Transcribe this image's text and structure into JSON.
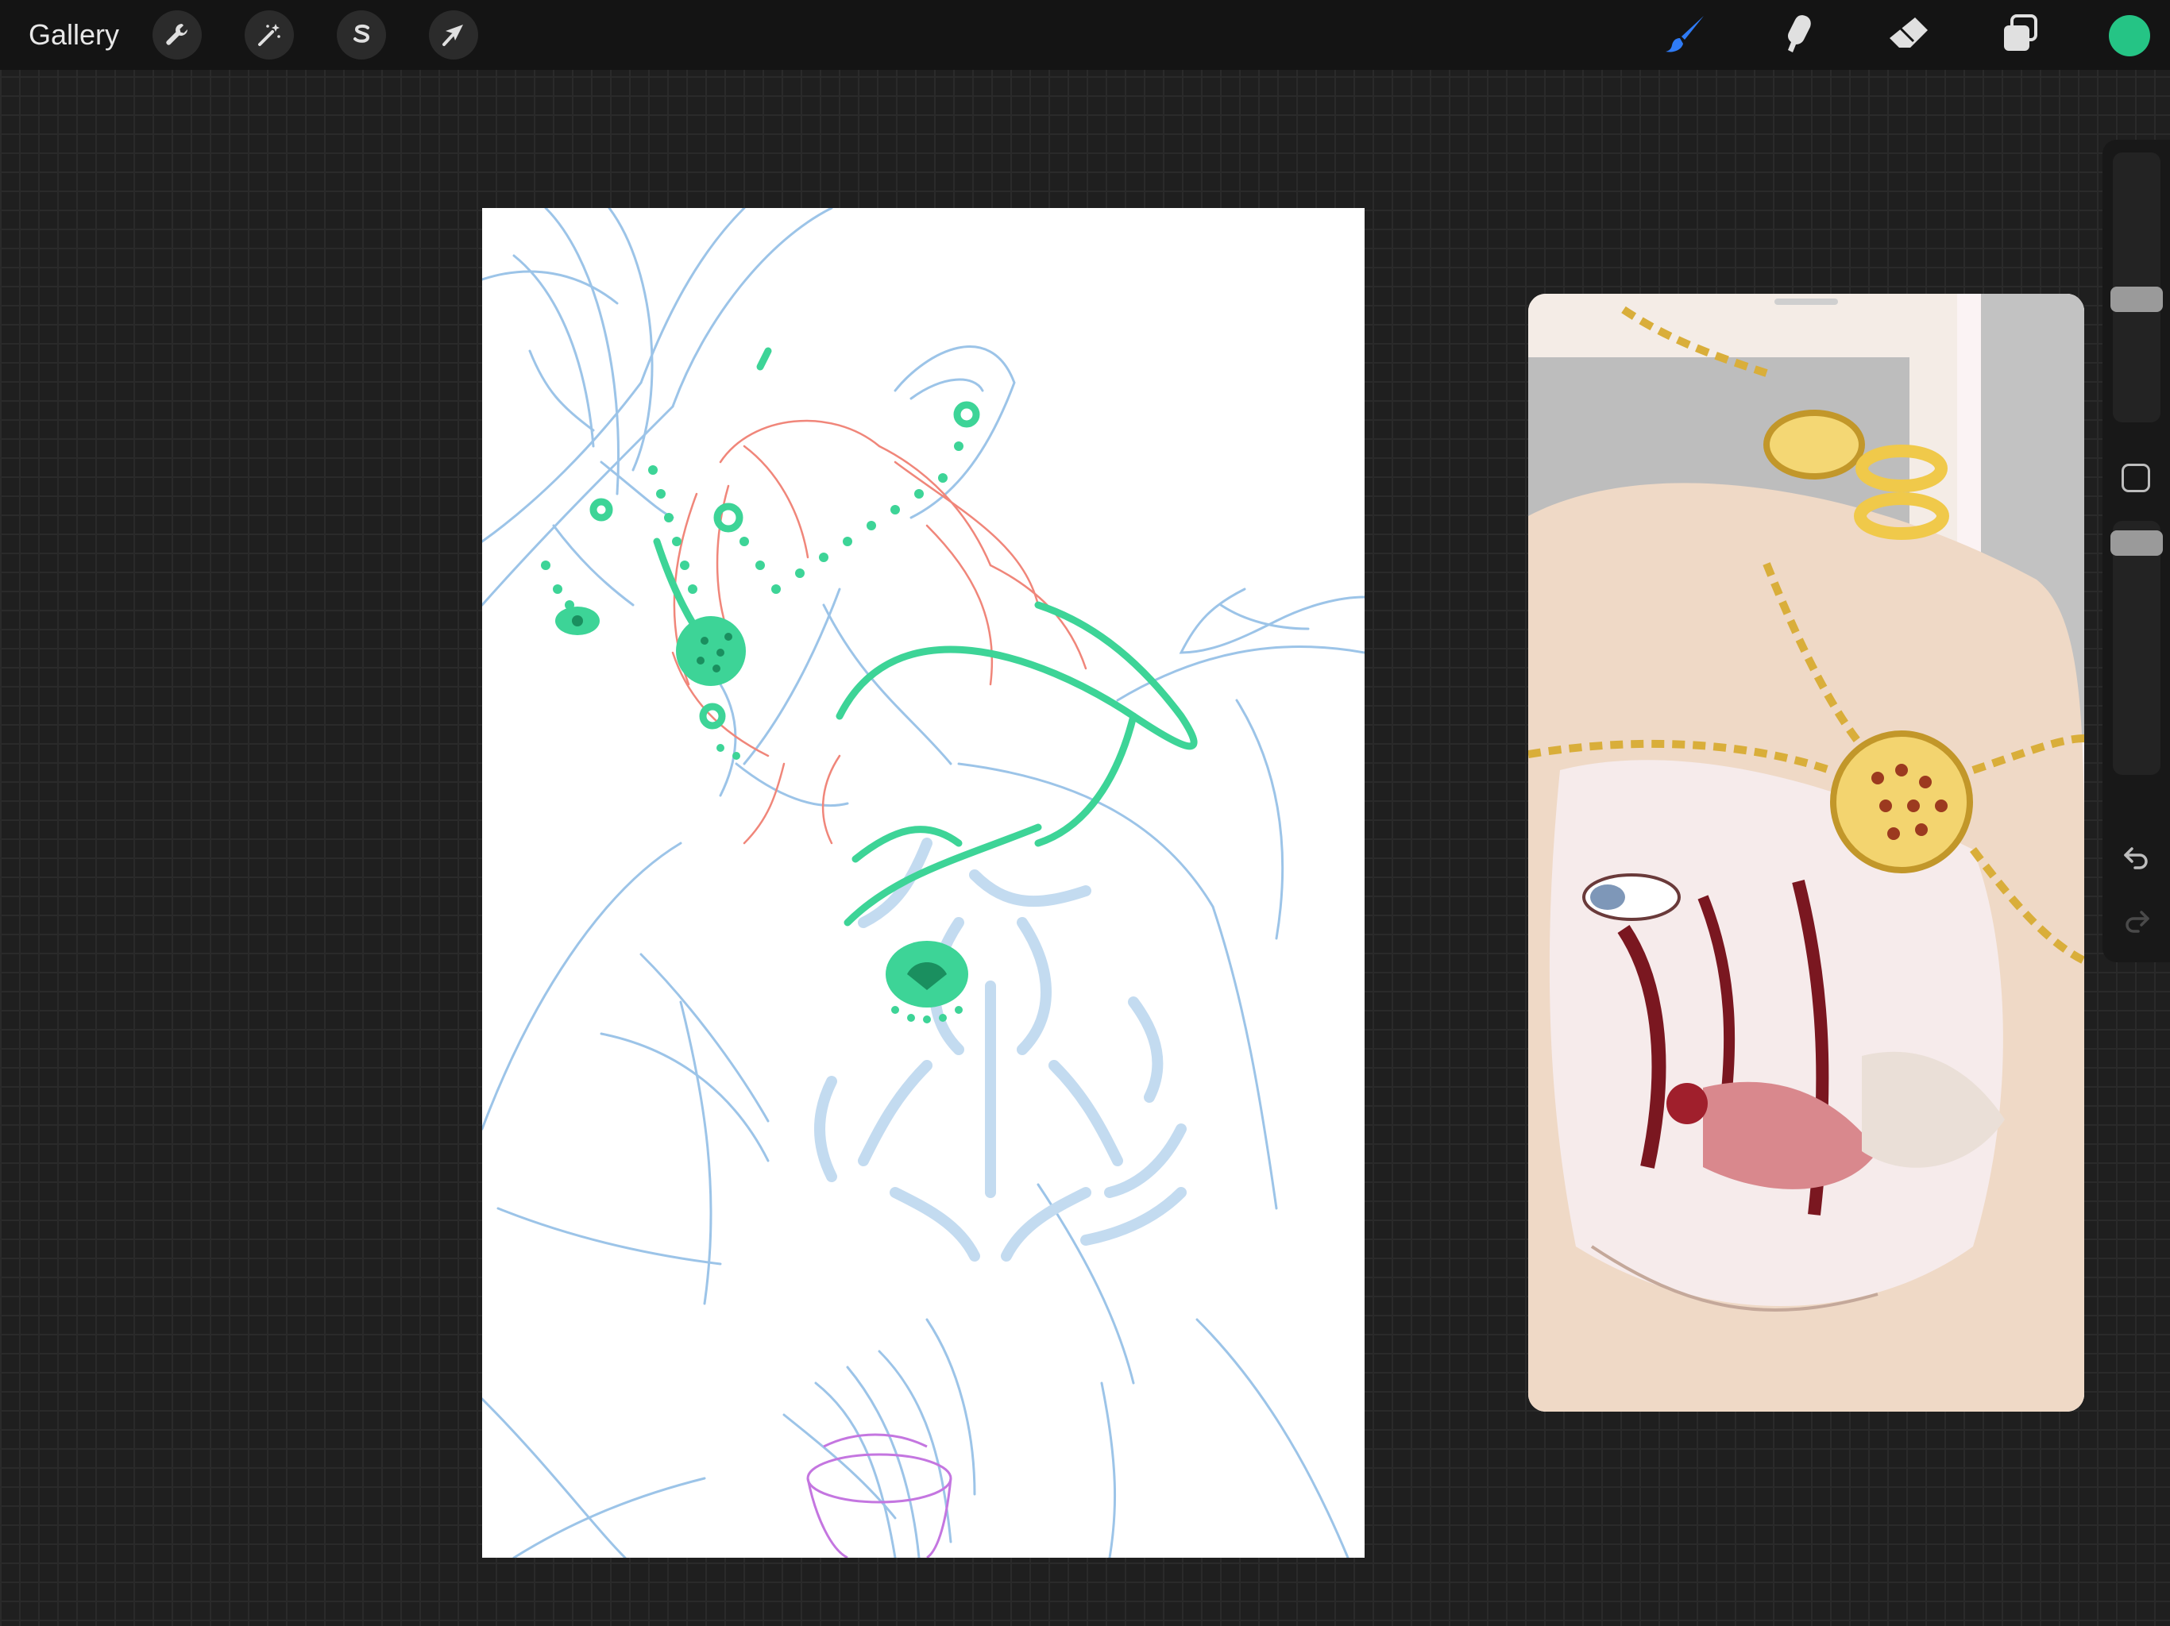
{
  "app": {
    "gallery_label": "Gallery",
    "left_tools": [
      {
        "name": "actions",
        "icon": "wrench-icon"
      },
      {
        "name": "adjustments",
        "icon": "magic-wand-icon"
      },
      {
        "name": "selection",
        "icon": "selection-s-icon"
      },
      {
        "name": "transform",
        "icon": "arrow-cursor-icon"
      }
    ],
    "right_tools": [
      {
        "name": "brush",
        "icon": "brush-icon",
        "active": true
      },
      {
        "name": "smudge",
        "icon": "smudge-icon"
      },
      {
        "name": "eraser",
        "icon": "eraser-icon"
      },
      {
        "name": "layers",
        "icon": "layers-icon"
      }
    ],
    "current_color": "#25c485",
    "active_tool_color": "#2f7bf5"
  },
  "sidebar": {
    "size_slider_level": 0.45,
    "opacity_slider_level": 0.96,
    "undo_icon": "undo-icon",
    "redo_icon": "redo-icon",
    "modifier_icon": "square-modifier-icon"
  },
  "canvas": {
    "background": "#ffffff",
    "sketch_colors": {
      "base_lines": "#9cc4e8",
      "hair_lines": "#f0867a",
      "jewelry": "#3dd497",
      "glass_lines": "#c476e0"
    }
  },
  "reference_window": {
    "content": "reference-image"
  }
}
